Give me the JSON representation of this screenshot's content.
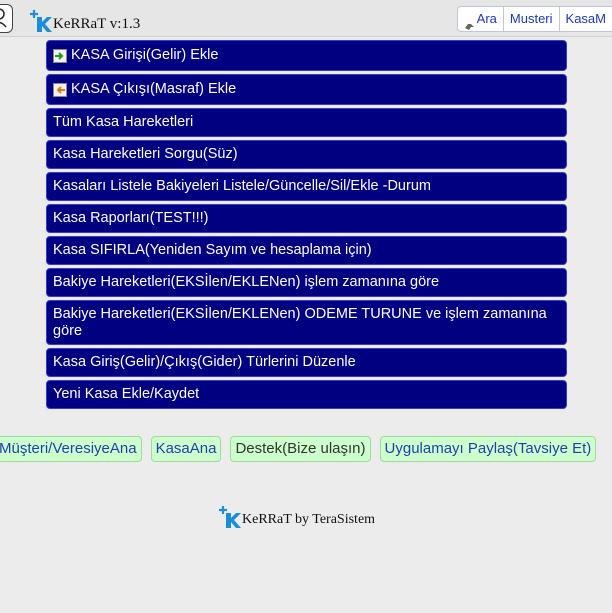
{
  "header": {
    "app_title": "KeRRaT v:1.3",
    "nav": [
      {
        "label": "Ara",
        "icon": "pin-icon"
      },
      {
        "label": "Musteri"
      },
      {
        "label": "KasaM"
      }
    ]
  },
  "menu": {
    "items": [
      {
        "label": "KASA Girişi(Gelir) Ekle",
        "icon": "income-arrow-icon"
      },
      {
        "label": "KASA Çıkışı(Masraf) Ekle",
        "icon": "expense-arrow-icon"
      },
      {
        "label": "Tüm Kasa Hareketleri"
      },
      {
        "label": "Kasa Hareketleri Sorgu(Süz)"
      },
      {
        "label": "Kasaları Listele Bakiyeleri Listele/Güncelle/Sil/Ekle -Durum"
      },
      {
        "label": "Kasa Raporları(TEST!!!)"
      },
      {
        "label": "Kasa SIFIRLA(Yeniden Sayım ve hesaplama için)"
      },
      {
        "label": "Bakiye Hareketleri(EKSİlen/EKLENen) işlem zamanına göre"
      },
      {
        "label": "Bakiye Hareketleri(EKSİlen/EKLENen) ODEME TURUNE ve işlem zamanına göre"
      },
      {
        "label": "Kasa Giriş(Gelir)/Çıkış(Gider) Türlerini Düzenle"
      },
      {
        "label": "Yeni Kasa Ekle/Kaydet"
      }
    ]
  },
  "links": [
    {
      "label": "Müşteri/VeresiyeAna"
    },
    {
      "label": "KasaAna"
    },
    {
      "label": "Destek(Bize ulaşın)"
    },
    {
      "label": "Uygulamayı Paylaş(Tavsiye Et)"
    }
  ],
  "footer": {
    "text": "KeRRaT by TeraSistem"
  },
  "colors": {
    "menu_bg": "#000080",
    "menu_text": "#ffffff",
    "link_bg": "#ccffcc",
    "logo_blue": "#1a8fd8",
    "nav_text": "#1a3ab8"
  }
}
